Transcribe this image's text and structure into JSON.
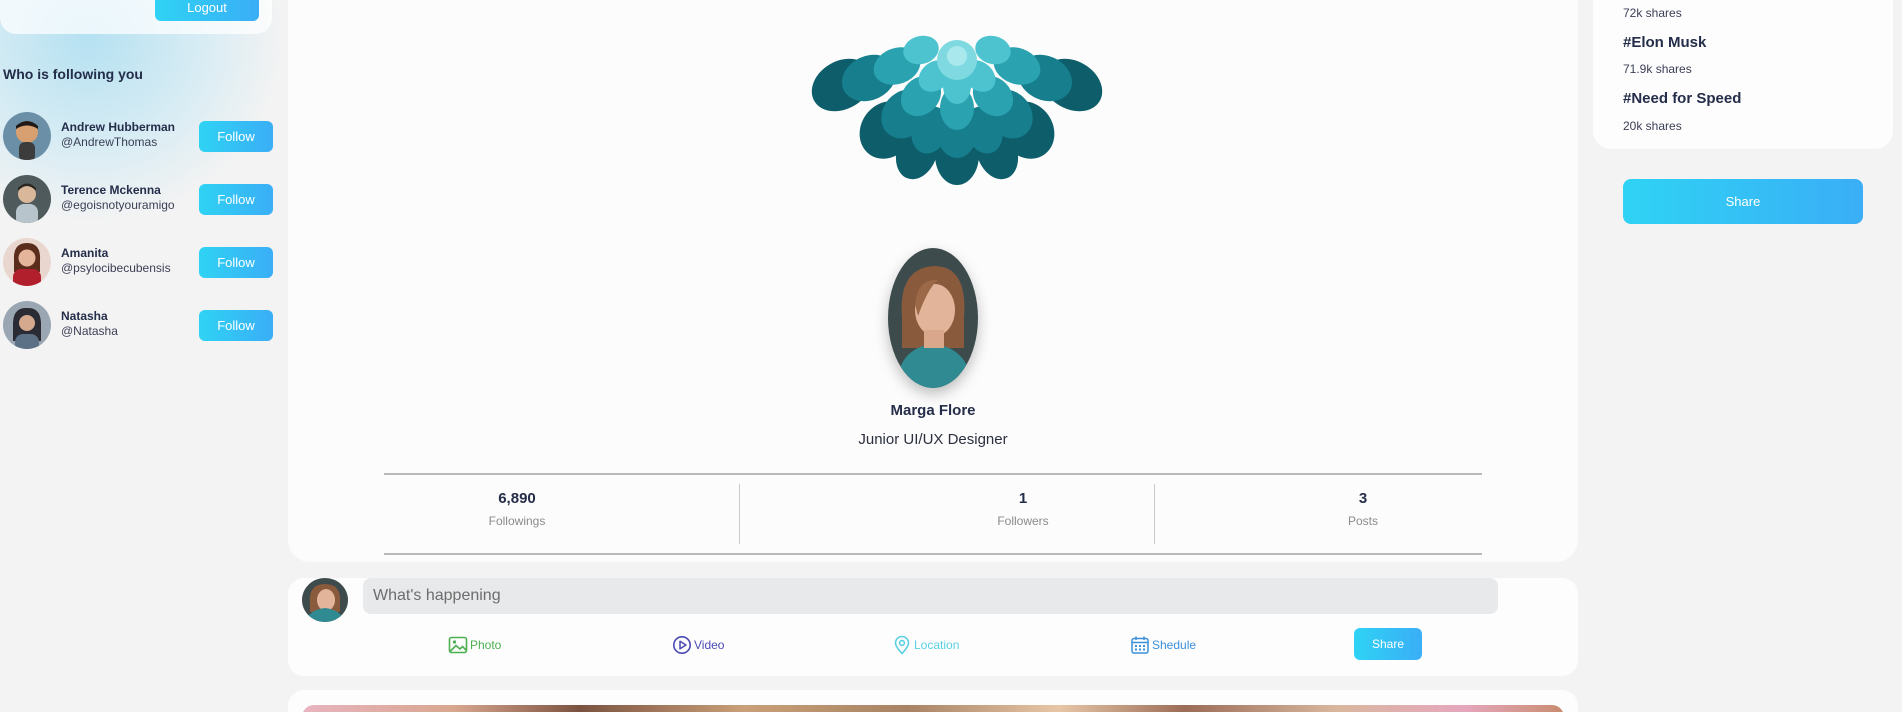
{
  "left": {
    "logout_label": "Logout",
    "following_title": "Who is following you",
    "followers": [
      {
        "name": "Andrew Hubberman",
        "handle": "@AndrewThomas",
        "button": "Follow",
        "avatar_color": "#c98e5e"
      },
      {
        "name": "Terence Mckenna",
        "handle": "@egoisnotyouramigo",
        "button": "Follow",
        "avatar_color": "#8f9ea3"
      },
      {
        "name": "Amanita",
        "handle": "@psylocibecubensis",
        "button": "Follow",
        "avatar_color": "#b23a42"
      },
      {
        "name": "Natasha",
        "handle": "@Natasha",
        "button": "Follow",
        "avatar_color": "#6f7e8f"
      }
    ]
  },
  "profile": {
    "name": "Marga Flore",
    "role": "Junior UI/UX Designer",
    "stats": [
      {
        "value": "6,890",
        "label": "Followings"
      },
      {
        "value": "1",
        "label": "Followers"
      },
      {
        "value": "3",
        "label": "Posts"
      }
    ]
  },
  "composer": {
    "placeholder": "What's happening",
    "options": [
      {
        "label": "Photo",
        "icon": "photo-icon",
        "color": "#4caf50"
      },
      {
        "label": "Video",
        "icon": "play-circle-icon",
        "color": "#4a4ab5"
      },
      {
        "label": "Location",
        "icon": "location-pin-icon",
        "color": "#5ad0e0"
      },
      {
        "label": "Shedule",
        "icon": "calendar-icon",
        "color": "#3c8fd9"
      }
    ],
    "share_label": "Share"
  },
  "trends": {
    "top_shares": "72k shares",
    "items": [
      {
        "tag": "#Elon Musk",
        "shares": "71.9k shares"
      },
      {
        "tag": "#Need for Speed",
        "shares": "20k shares"
      }
    ]
  },
  "right": {
    "share_label": "Share"
  },
  "colors": {
    "accent_start": "#2fd3f4",
    "accent_end": "#3aaef6",
    "text_dark": "#242d49",
    "background": "#f3f3f3"
  }
}
